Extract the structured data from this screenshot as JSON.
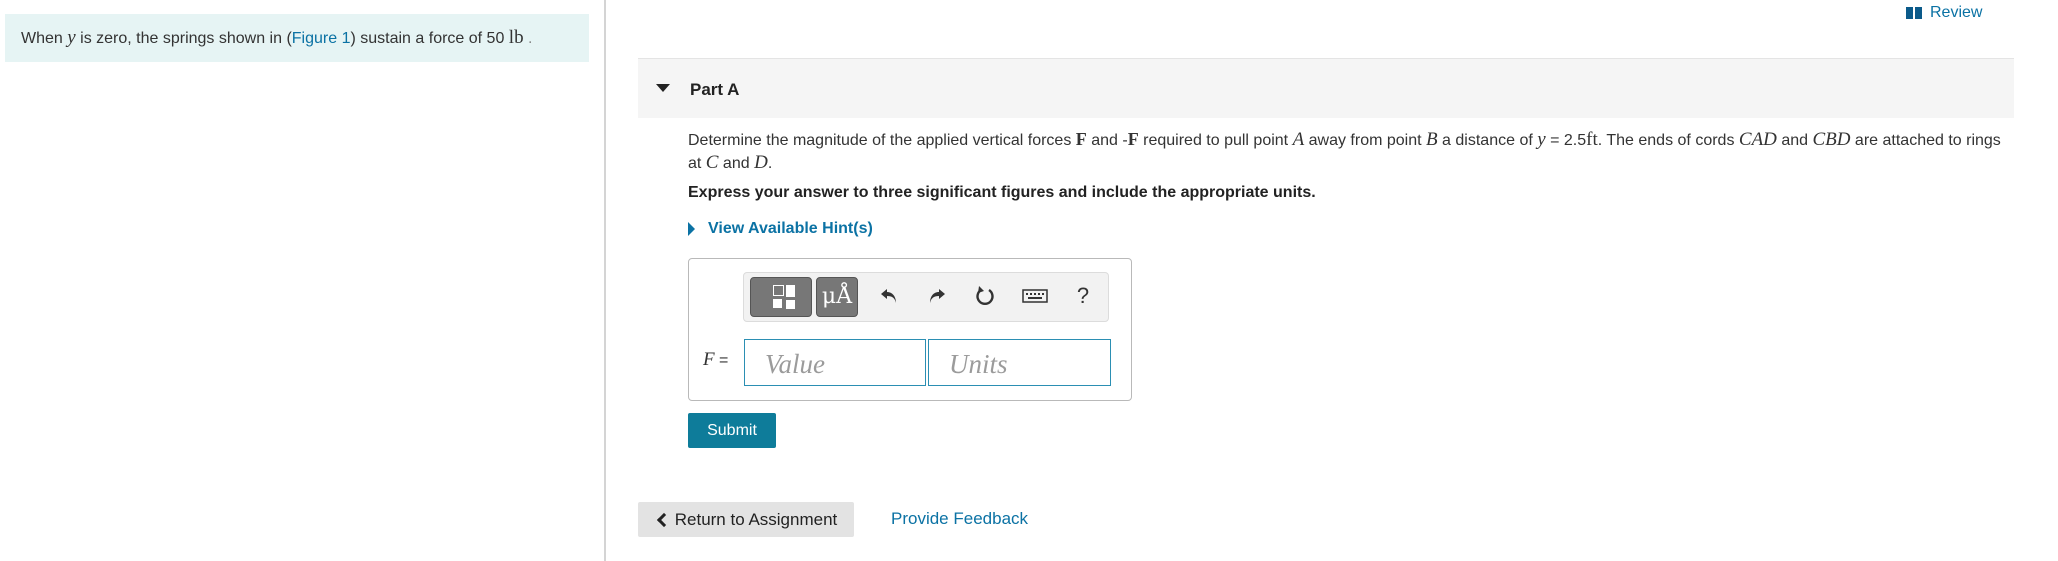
{
  "intro": {
    "text_before_y": "When ",
    "var_y": "y",
    "text_after_y": " is zero, the springs shown in (",
    "figure_link": "Figure 1",
    "text_after_link": ") sustain a force of 50 ",
    "unit": "lb",
    "end": " ."
  },
  "review": {
    "label": "Review",
    "icon": "book-icon"
  },
  "part": {
    "title": "Part A"
  },
  "question": {
    "t1": "Determine the magnitude of the applied vertical forces ",
    "F1": "F",
    "t2": " and -",
    "F2": "F",
    "t3": " required to pull point ",
    "A": "A",
    "t4": " away from point ",
    "B": "B",
    "t5": " a distance of ",
    "y": "y",
    "t6": " = 2.5",
    "ft": "ft",
    "t7": ". The ends of cords ",
    "CAD": "CAD",
    "t8": " and ",
    "CBD": "CBD",
    "t9": " are attached to rings at ",
    "C": "C",
    "t10": " and ",
    "D": "D",
    "t11": "."
  },
  "instruction": "Express your answer to three significant figures and include the appropriate units.",
  "hints": {
    "label": "View Available Hint(s)"
  },
  "toolbar": {
    "templates_icon": "templates-icon",
    "symbols_label": "μÅ",
    "undo_icon": "undo-icon",
    "redo_icon": "redo-icon",
    "reset_icon": "reset-icon",
    "keyboard_icon": "keyboard-icon",
    "help_label": "?"
  },
  "answer": {
    "var": "F",
    "equals": " =",
    "value_placeholder": "Value",
    "units_placeholder": "Units"
  },
  "submit_label": "Submit",
  "return_label": "Return to Assignment",
  "feedback_label": "Provide Feedback",
  "colors": {
    "link": "#0b72a4",
    "submit": "#0e7c9a",
    "panel": "#e6f4f4"
  }
}
